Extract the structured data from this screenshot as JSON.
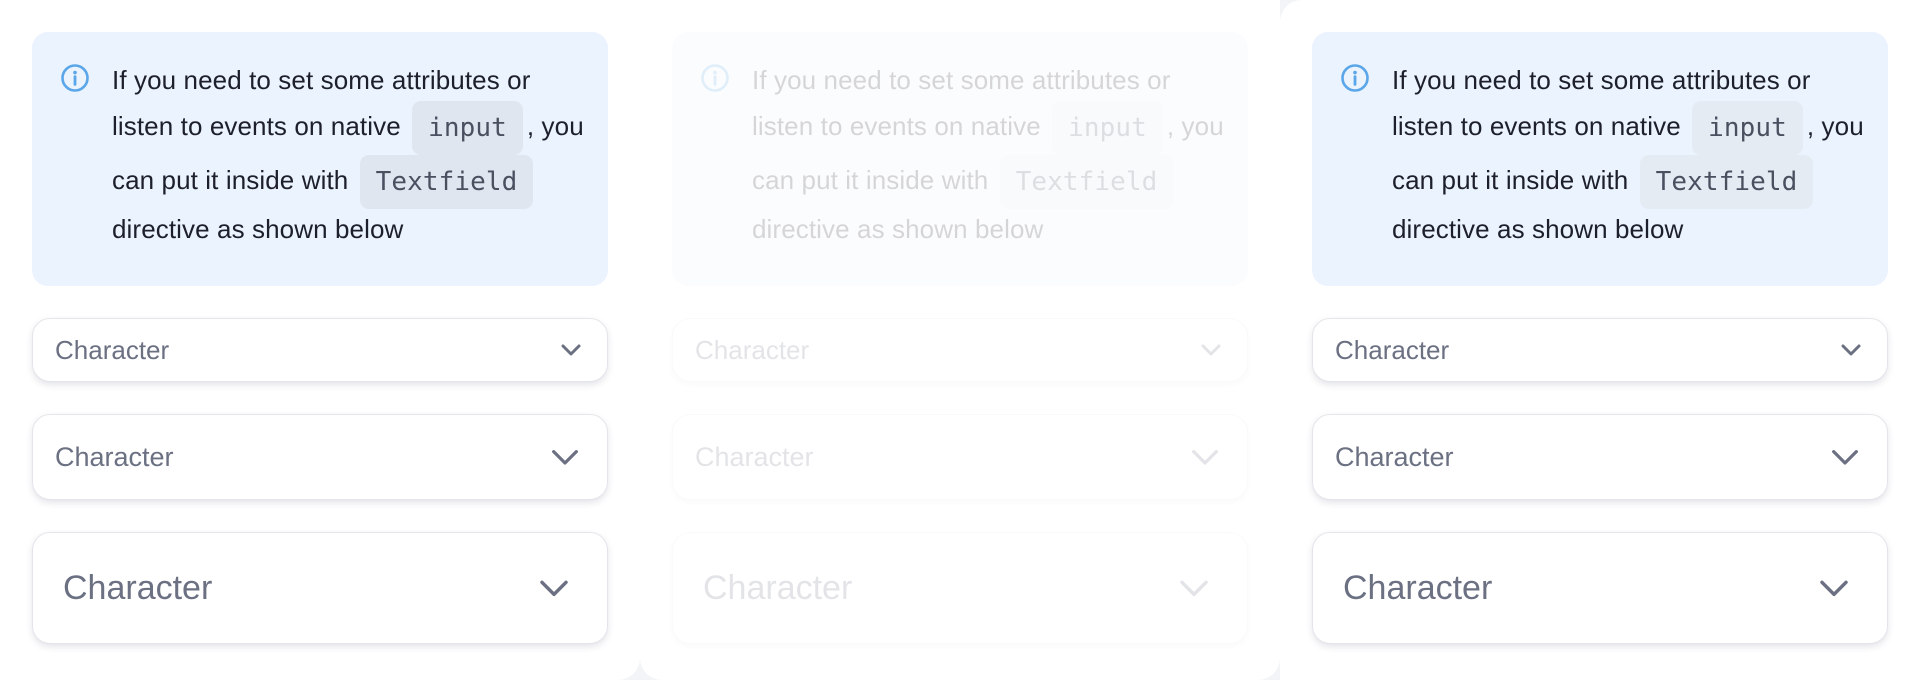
{
  "colors": {
    "alert_background": "#eaf3fe",
    "info_icon": "#5aa6e8",
    "code_background": "#dfe6ef",
    "select_text": "#6b7082",
    "page_background": "#f3f4f7"
  },
  "panels": [
    {
      "state": "default",
      "alert": {
        "icon": "info-circle-icon",
        "text_1": "If you need to set some attributes or listen to events on native",
        "code_1": "input",
        "text_2": ", you can put it inside with",
        "code_2": "Textfield",
        "text_3": "directive as shown below"
      },
      "selects": [
        {
          "size": "small",
          "placeholder": "Character",
          "icon": "chevron-down-icon"
        },
        {
          "size": "medium",
          "placeholder": "Character",
          "icon": "chevron-down-icon"
        },
        {
          "size": "large",
          "placeholder": "Character",
          "icon": "chevron-down-icon"
        }
      ]
    },
    {
      "state": "disabled",
      "alert": {
        "icon": "info-circle-icon",
        "text_1": "If you need to set some attributes or listen to events on native",
        "code_1": "input",
        "text_2": ", you can put it inside with",
        "code_2": "Textfield",
        "text_3": "directive as shown below"
      },
      "selects": [
        {
          "size": "small",
          "placeholder": "Character",
          "icon": "chevron-down-icon"
        },
        {
          "size": "medium",
          "placeholder": "Character",
          "icon": "chevron-down-icon"
        },
        {
          "size": "large",
          "placeholder": "Character",
          "icon": "chevron-down-icon"
        }
      ]
    },
    {
      "state": "default",
      "alert": {
        "icon": "info-circle-icon",
        "text_1": "If you need to set some attributes or listen to events on native",
        "code_1": "input",
        "text_2": ", you can put it inside with",
        "code_2": "Textfield",
        "text_3": "directive as shown below"
      },
      "selects": [
        {
          "size": "small",
          "placeholder": "Character",
          "icon": "chevron-down-icon"
        },
        {
          "size": "medium",
          "placeholder": "Character",
          "icon": "chevron-down-icon"
        },
        {
          "size": "large",
          "placeholder": "Character",
          "icon": "chevron-down-icon"
        }
      ]
    }
  ]
}
